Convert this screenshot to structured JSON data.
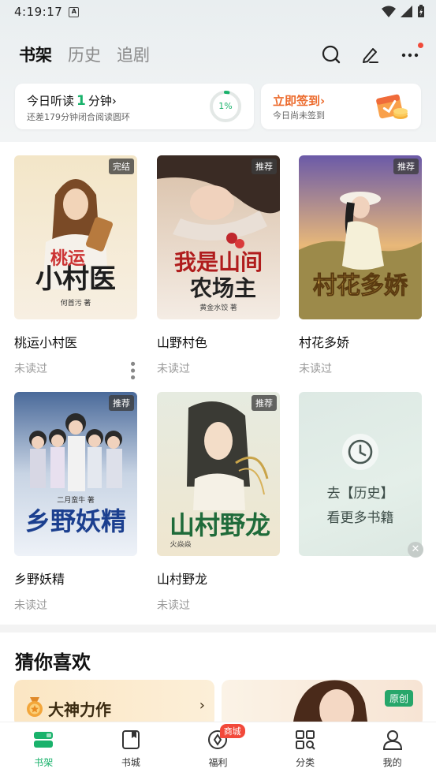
{
  "status_bar": {
    "time": "4:19:17",
    "notif_letter": "A"
  },
  "tabs": [
    {
      "label": "书架",
      "active": true
    },
    {
      "label": "历史",
      "active": false
    },
    {
      "label": "追剧",
      "active": false
    }
  ],
  "listen_card": {
    "prefix": "今日听读",
    "minutes": "1",
    "suffix": "分钟›",
    "sub": "还差179分钟闭合阅读圆环",
    "percent": "1%",
    "progress": 0.01
  },
  "sign_card": {
    "title": "立即签到›",
    "sub": "今日尚未签到"
  },
  "books": [
    {
      "title": "桃运小村医",
      "status": "未读过",
      "badge": "完结",
      "cover_text": "桃运小村医",
      "author": "何首污 著",
      "show_more": true
    },
    {
      "title": "山野村色",
      "status": "未读过",
      "badge": "推荐",
      "cover_text": "我是山间农场主",
      "author": "黄金水饺 著",
      "show_more": false
    },
    {
      "title": "村花多娇",
      "status": "未读过",
      "badge": "推荐",
      "cover_text": "村花多娇",
      "author": "",
      "show_more": false
    },
    {
      "title": "乡野妖精",
      "status": "未读过",
      "badge": "推荐",
      "cover_text": "乡野妖精",
      "author": "二月蛮牛 著",
      "show_more": false
    },
    {
      "title": "山村野龙",
      "status": "未读过",
      "badge": "推荐",
      "cover_text": "山村野龙",
      "author": "火焱焱",
      "show_more": false
    }
  ],
  "history_tile": {
    "line1": "去【历史】",
    "line2": "看更多书籍",
    "close": "✕"
  },
  "guess": {
    "title": "猜你喜欢",
    "rec_label": "大神力作",
    "rec_arrow": "›",
    "promo_badge": "原创"
  },
  "nav": [
    {
      "label": "书架",
      "icon": "bookshelf-icon",
      "active": true
    },
    {
      "label": "书城",
      "icon": "bookstore-icon",
      "active": false
    },
    {
      "label": "福利",
      "icon": "welfare-icon",
      "active": false,
      "badge": "商城"
    },
    {
      "label": "分类",
      "icon": "category-icon",
      "active": false
    },
    {
      "label": "我的",
      "icon": "profile-icon",
      "active": false
    }
  ],
  "colors": {
    "accent": "#19b26b",
    "sign": "#ec6b2d",
    "badge_red": "#f2493a"
  }
}
